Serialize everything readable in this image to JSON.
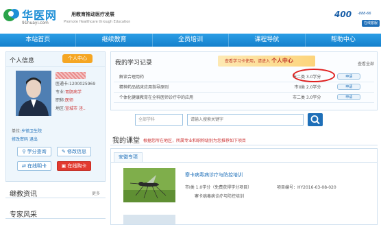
{
  "header": {
    "logo_text": "华医网",
    "logo_url": "91huayi.com",
    "slogan": "用教育推动医疗发展",
    "slogan_en": "Promote Healthcare through Education",
    "hotline": "400",
    "hotline_small": "-888-66",
    "qq_label": "在线客服"
  },
  "nav": {
    "items": [
      "本站首页",
      "继续教育",
      "全员培训",
      "课程导航",
      "帮助中心"
    ]
  },
  "left": {
    "info_title": "个人信息",
    "center_button": "个人中心",
    "card_line": "医通卡:1200025969",
    "major_label": "专业:",
    "major_value": "胃肠病学",
    "title_label": "职称:",
    "title_value": "医师",
    "region_label": "地区:",
    "region_value": "宣城市 泾..",
    "unit_label": "单位:",
    "unit_value": "乡镇卫生院",
    "edit_links": "修改密码  退出",
    "btn_credit_query": "学分查询",
    "btn_edit_info": "修改信息",
    "btn_online_study": "在线明卡",
    "btn_buy_card": "在线购卡",
    "news_title": "继教资讯",
    "news_more": "更多",
    "expert_title": "专家风采"
  },
  "records": {
    "title": "我的学习记录",
    "promo_text": "查看学习卡使用，请进入",
    "promo_strong": "个人中心",
    "view_all": "查看全部",
    "rows": [
      {
        "name": "解读合理用药",
        "credit": "市二类 3.0学分",
        "action": "申请"
      },
      {
        "name": "精神药品临床应用指导原则",
        "credit": "市II类 2.0学分",
        "action": "申请"
      },
      {
        "name": "个体化健康教育在全科医师诊疗中的应用",
        "credit": "市二类 3.0学分",
        "action": "申请"
      }
    ]
  },
  "search": {
    "category_placeholder": "全部学科",
    "keyword_placeholder": "请输入搜索关键字"
  },
  "courses": {
    "title": "我的课堂",
    "note": "根据您所在地区，所属专业和职称级别为您推荐如下项目",
    "tab": "安徽专项",
    "item_title": "寨卡病毒病诊疗与防控培训",
    "item_meta": "市I类 1.0学分（免费获得学分项目）",
    "item_project": "项目编号：HY2016-03-08-020",
    "item_intro": "寨卡病毒病诊疗与防控培训"
  },
  "colors": {
    "nav_blue": "#1e8fd6",
    "accent_orange": "#f5a623",
    "highlight_red": "#e0201f"
  }
}
